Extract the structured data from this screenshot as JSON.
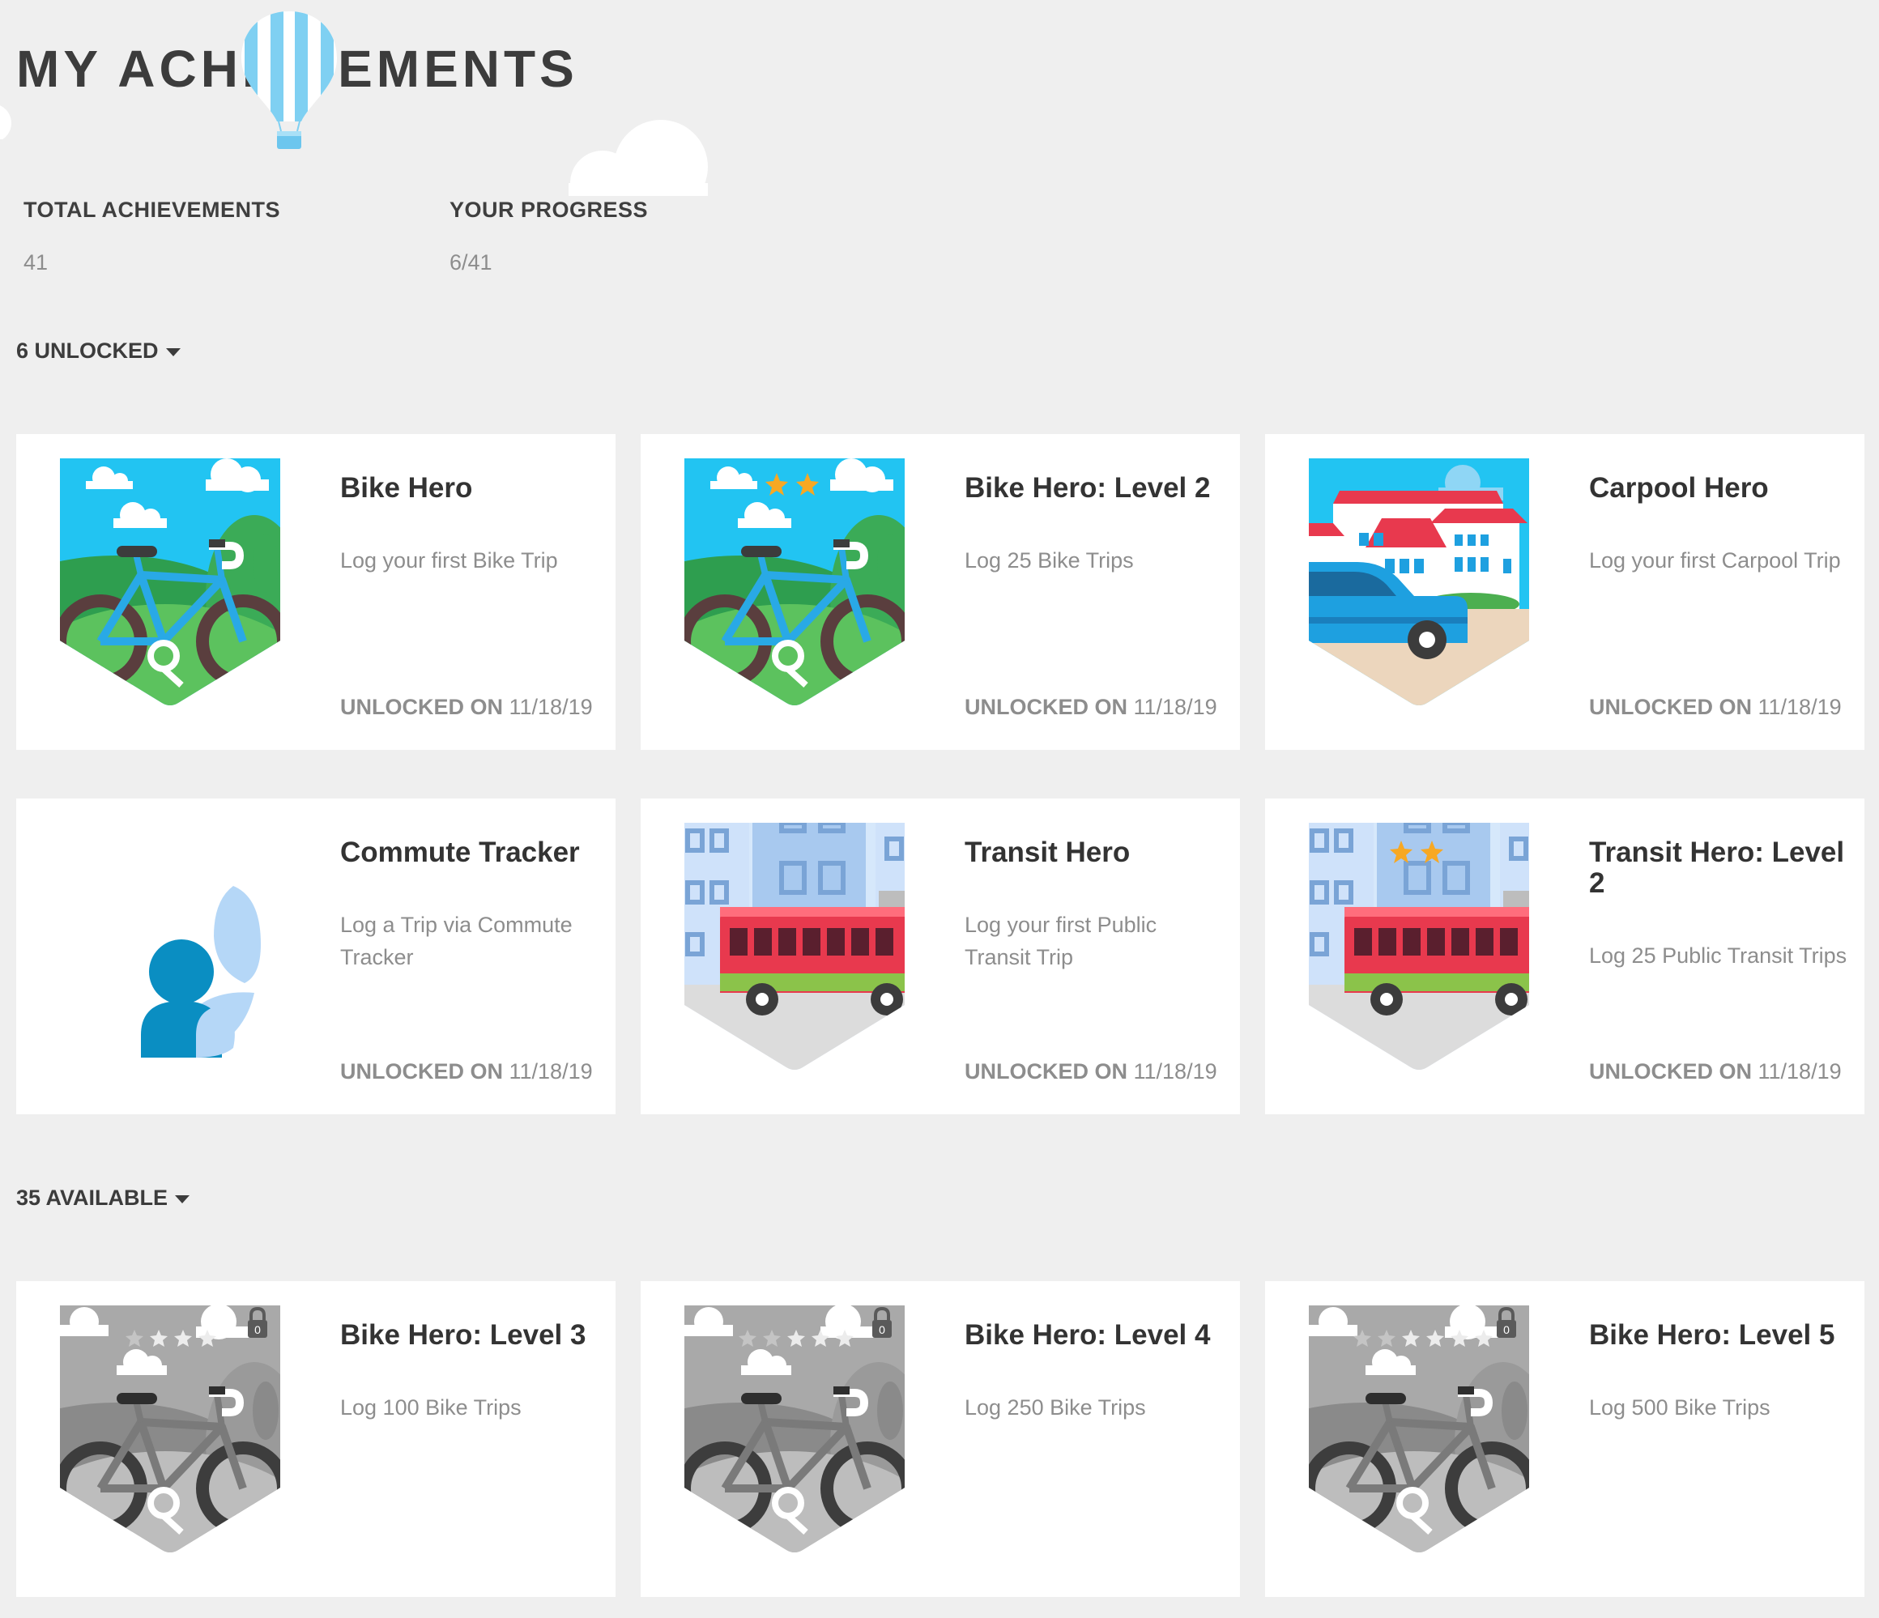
{
  "header": {
    "title": "MY ACHIEVEMENTS"
  },
  "stats": [
    {
      "label": "TOTAL ACHIEVEMENTS",
      "value": "41"
    },
    {
      "label": "YOUR PROGRESS",
      "value": "6/41"
    }
  ],
  "sections": {
    "unlocked": {
      "label": "6 UNLOCKED"
    },
    "available": {
      "label": "35 AVAILABLE"
    }
  },
  "unlocked_prefix": "UNLOCKED ON",
  "unlocked": [
    {
      "title": "Bike Hero",
      "description": "Log your first Bike Trip",
      "date": "11/18/19",
      "badge": "bike-badge-icon",
      "stars": 0
    },
    {
      "title": "Bike Hero: Level 2",
      "description": "Log 25 Bike Trips",
      "date": "11/18/19",
      "badge": "bike-badge-icon",
      "stars": 2
    },
    {
      "title": "Carpool Hero",
      "description": "Log your first Carpool Trip",
      "date": "11/18/19",
      "badge": "carpool-badge-icon",
      "stars": 0
    },
    {
      "title": "Commute Tracker",
      "description": "Log a Trip via Commute Tracker",
      "date": "11/18/19",
      "badge": "commute-tracker-badge-icon",
      "stars": 0
    },
    {
      "title": "Transit Hero",
      "description": "Log your first Public Transit Trip",
      "date": "11/18/19",
      "badge": "transit-badge-icon",
      "stars": 0
    },
    {
      "title": "Transit Hero: Level 2",
      "description": "Log 25 Public Transit Trips",
      "date": "11/18/19",
      "badge": "transit-badge-icon",
      "stars": 2
    }
  ],
  "available": [
    {
      "title": "Bike Hero: Level 3",
      "description": "Log 100 Bike Trips",
      "badge": "locked-bike-badge-icon",
      "stars": 3,
      "lock_count": "0"
    },
    {
      "title": "Bike Hero: Level 4",
      "description": "Log 250 Bike Trips",
      "badge": "locked-bike-badge-icon",
      "stars": 4,
      "lock_count": "0"
    },
    {
      "title": "Bike Hero: Level 5",
      "description": "Log 500 Bike Trips",
      "badge": "locked-bike-badge-icon",
      "stars": 5,
      "lock_count": "0"
    }
  ],
  "colors": {
    "background": "#efefef",
    "card": "#ffffff",
    "title_text": "#333333",
    "muted_text": "#8d8d8d",
    "sky": "#22c4f2",
    "bike_frame": "#29a9e6",
    "grass": "#4caf50",
    "bus_red": "#e8394e",
    "car_blue": "#1ea0e0",
    "commute_dark": "#0a8ec2",
    "commute_light": "#b5d7f7",
    "star": "#f7a823"
  }
}
